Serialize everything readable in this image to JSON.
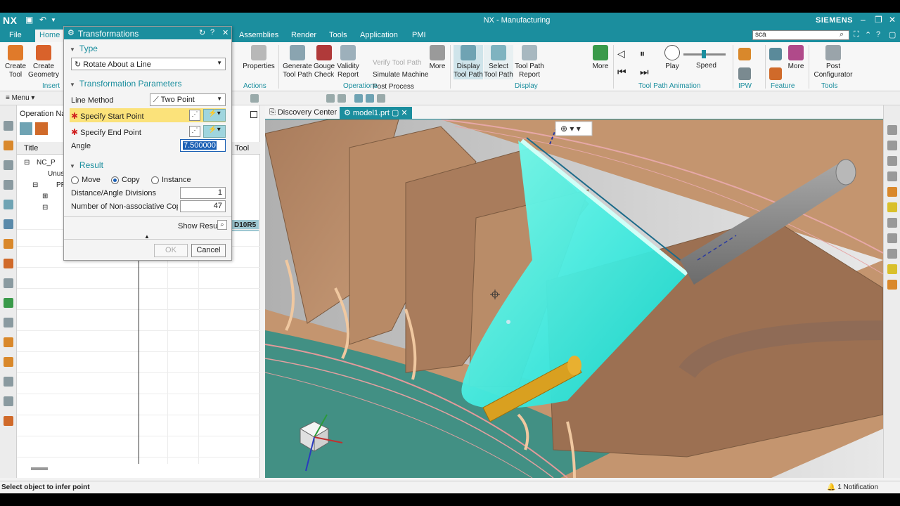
{
  "app": {
    "logo": "NX",
    "window_title": "NX - Manufacturing",
    "brand": "SIEMENS",
    "search_value": "sca"
  },
  "menu": {
    "file": "File",
    "home": "Home",
    "tabs": [
      "Assemblies",
      "Render",
      "Tools",
      "Application",
      "PMI"
    ]
  },
  "ribbon": {
    "create_tool": [
      "Create",
      "Tool"
    ],
    "create_geometry": [
      "Create",
      "Geometry"
    ],
    "insert_group": "Insert",
    "properties": "Properties",
    "actions_group": "Actions",
    "generate_tool_path": [
      "Generate",
      "Tool Path"
    ],
    "gouge_check": [
      "Gouge",
      "Check"
    ],
    "validity_report": [
      "Validity",
      "Report"
    ],
    "verify_tool_path": "Verify Tool Path",
    "simulate_machine": "Simulate Machine",
    "post_process": "Post Process",
    "more_ops": "More",
    "operations_group": "Operations",
    "display_tool_path": [
      "Display",
      "Tool Path"
    ],
    "select_tool_path": [
      "Select",
      "Tool Path"
    ],
    "tool_path_report": [
      "Tool Path",
      "Report"
    ],
    "display_group": "Display",
    "more_display": "More",
    "play": "Play",
    "speed": "Speed",
    "anim_group": "Tool Path Animation",
    "ipw_group": "IPW",
    "more_feature": "More",
    "feature_group": "Feature",
    "post_configurator": [
      "Post",
      "Configurator"
    ],
    "tools_group": "Tools"
  },
  "toolbar2": {
    "menu": "Menu"
  },
  "nav": {
    "header": "Operation Nav",
    "col_title": "Title",
    "col_tool": "Tool",
    "rows": [
      "NC_P",
      "Unus",
      "PR"
    ],
    "tool_value": "D10R5"
  },
  "viewport_tabs": {
    "discovery": "Discovery Center",
    "model": "model1.prt"
  },
  "dialog": {
    "title": "Transformations",
    "type_section": "Type",
    "type_value": "Rotate About a Line",
    "params_section": "Transformation Parameters",
    "line_method_label": "Line Method",
    "line_method_value": "Two Point",
    "start_point": "Specify Start Point",
    "end_point": "Specify End Point",
    "angle_label": "Angle",
    "angle_value": "7.500000",
    "result_section": "Result",
    "move": "Move",
    "copy": "Copy",
    "instance": "Instance",
    "divisions_label": "Distance/Angle Divisions",
    "divisions_value": "1",
    "copies_label": "Number of Non-associative Copies",
    "copies_value": "47",
    "show_result": "Show Result",
    "ok": "OK",
    "cancel": "Cancel"
  },
  "status": {
    "message": "Select object to infer point",
    "notification": "1 Notification"
  }
}
